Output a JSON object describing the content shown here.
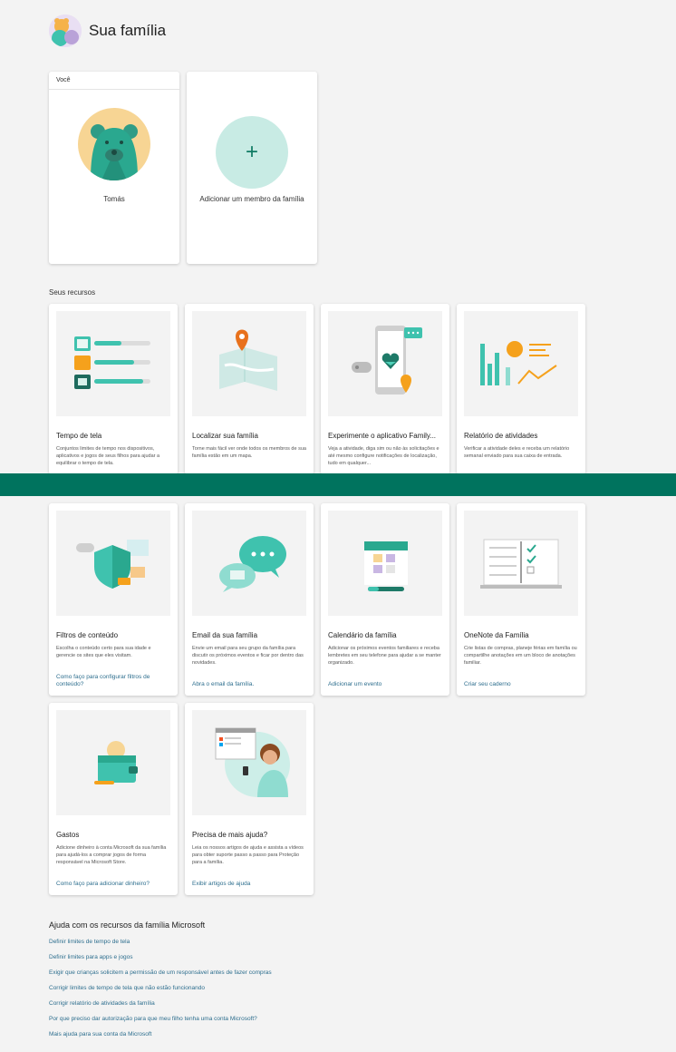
{
  "header": {
    "title": "Sua família"
  },
  "members": [
    {
      "tag": "Você",
      "name": "Tomás"
    },
    {
      "add_label": "Adicionar um membro da família",
      "icon": "plus"
    }
  ],
  "resources": {
    "section_label": "Seus recursos",
    "cards": [
      {
        "title": "Tempo de tela",
        "desc": "Conjuntos limites de tempo nos dispositivos, aplicativos e jogos de seus filhos para ajudar a equilibrar o tempo de tela.",
        "link": ""
      },
      {
        "title": "Localizar sua família",
        "desc": "Torne mais fácil ver onde todos os membros de sua família estão em um mapa.",
        "link": ""
      },
      {
        "title": "Experimente o aplicativo Family...",
        "desc": "Veja a atividade, diga sim ou não às solicitações e até mesmo configure notificações de localização, tudo em qualquer...",
        "link": ""
      },
      {
        "title": "Relatório de atividades",
        "desc": "Verificar a atividade deles e receba um relatório semanal enviado para sua caixa de entrada.",
        "link": ""
      },
      {
        "title": "Filtros de conteúdo",
        "desc": "Escolha o conteúdo certo para sua idade e gerencie os sites que eles visitam.",
        "link": "Como faço para configurar filtros de conteúdo?"
      },
      {
        "title": "Email da sua família",
        "desc": "Envie um email para seu grupo da família para discutir os próximos eventos e ficar por dentro das novidades.",
        "link": "Abra o email da família."
      },
      {
        "title": "Calendário da família",
        "desc": "Adicionar os próximos eventos familiares e receba lembretes em seu telefone para ajudar a se manter organizado.",
        "link": "Adicionar um evento"
      },
      {
        "title": "OneNote da Família",
        "desc": "Crie listas de compras, planeje férias em família ou compartilhe anotações em um bloco de anotações familiar.",
        "link": "Criar seu caderno"
      },
      {
        "title": "Gastos",
        "desc": "Adicione dinheiro à conta Microsoft da sua família para ajudá-los a comprar jogos de forma responsável na Microsoft Store.",
        "link": "Como faço para adicionar dinheiro?"
      },
      {
        "title": "Precisa de mais ajuda?",
        "desc": "Leia os nossos artigos de ajuda e assista a vídeos para obter suporte passo a passo para Proteção para a família.",
        "link": "Exibir artigos de ajuda"
      }
    ]
  },
  "help": {
    "title": "Ajuda com os recursos da família Microsoft",
    "items": [
      "Definir limites de tempo de tela",
      "Definir limites para apps e jogos",
      "Exigir que crianças solicitem a permissão de um responsável antes de fazer compras",
      "Corrigir limites de tempo de tela que não estão funcionando",
      "Corrigir relatório de atividades da família",
      "Por que preciso dar autorização para que meu filho tenha uma conta Microsoft?",
      "Mais ajuda para sua conta da Microsoft"
    ]
  },
  "colors": {
    "accent": "#00735e",
    "link": "#2d6e8e",
    "teal": "#3fc2ae"
  }
}
